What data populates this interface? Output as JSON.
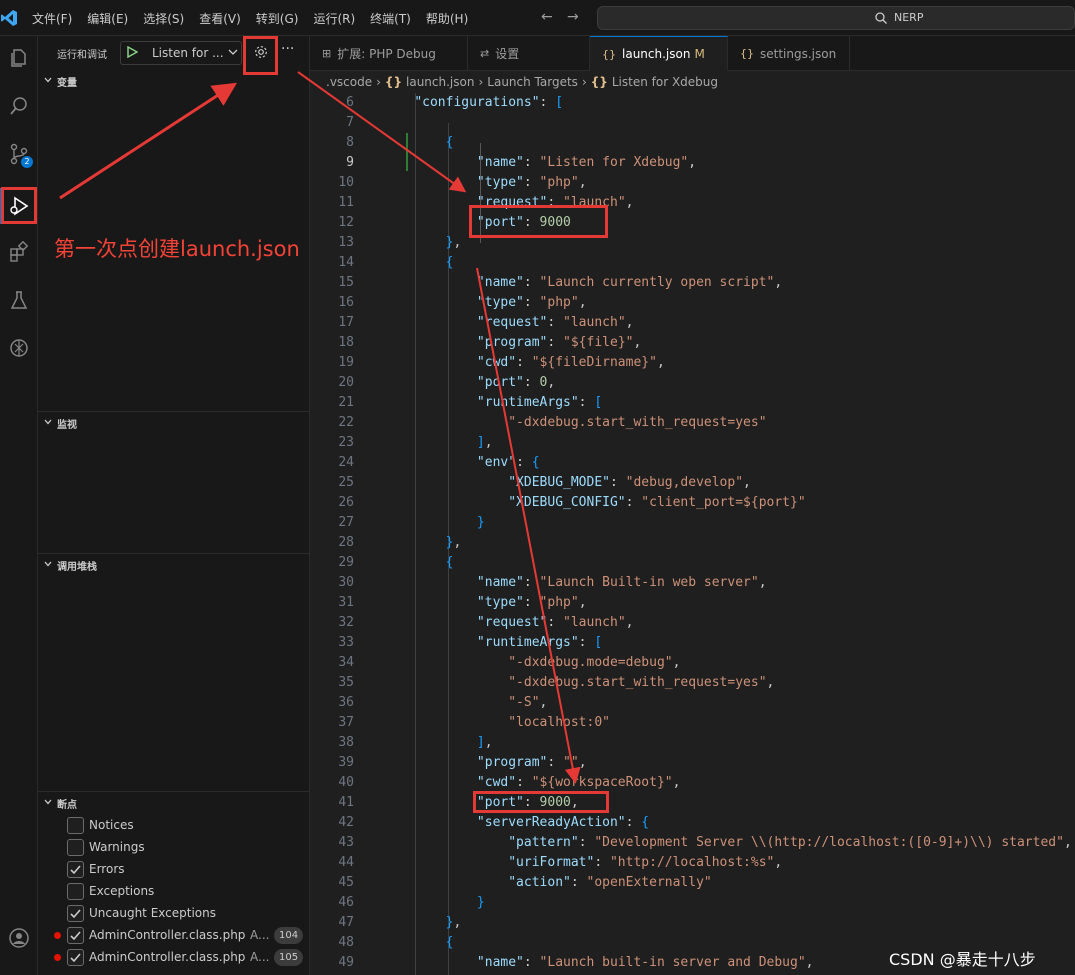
{
  "menu": [
    "文件(F)",
    "编辑(E)",
    "选择(S)",
    "查看(V)",
    "转到(G)",
    "运行(R)",
    "终端(T)",
    "帮助(H)"
  ],
  "command_center": {
    "label": "NERP"
  },
  "activity": {
    "scm_badge": "2"
  },
  "sidebar": {
    "title": "运行和调试",
    "run_config": "Listen for ...",
    "sections": {
      "variables": "变量",
      "watch": "监视",
      "call_stack": "调用堆栈",
      "breakpoints": "断点"
    },
    "breakpoints": [
      {
        "label": "Notices",
        "checked": false
      },
      {
        "label": "Warnings",
        "checked": false
      },
      {
        "label": "Errors",
        "checked": true
      },
      {
        "label": "Exceptions",
        "checked": false
      },
      {
        "label": "Uncaught Exceptions",
        "checked": true
      },
      {
        "label": "AdminController.class.php",
        "checked": true,
        "extra": "A...",
        "count": "104"
      },
      {
        "label": "AdminController.class.php",
        "checked": true,
        "extra": "A...",
        "count": "105"
      }
    ]
  },
  "tabs": [
    {
      "label": "扩展: PHP Debug",
      "icon": "extensions-icon"
    },
    {
      "label": "设置",
      "icon": "settings-icon"
    },
    {
      "label": "launch.json",
      "icon": "json-icon",
      "modified": "M",
      "active": true
    },
    {
      "label": "settings.json",
      "icon": "json-icon"
    }
  ],
  "breadcrumb": {
    "folder": ".vscode",
    "file": "launch.json",
    "section": "Launch Targets",
    "item": "Listen for Xdebug"
  },
  "editor": {
    "current_line": 9,
    "lines": [
      {
        "n": 6,
        "t": "    \"configurations\": ["
      },
      {
        "n": 7,
        "t": ""
      },
      {
        "n": 8,
        "t": "        {"
      },
      {
        "n": 9,
        "t": "            \"name\": \"Listen for Xdebug\","
      },
      {
        "n": 10,
        "t": "            \"type\": \"php\","
      },
      {
        "n": 11,
        "t": "            \"request\": \"launch\","
      },
      {
        "n": 12,
        "t": "            \"port\": 9000"
      },
      {
        "n": 13,
        "t": "        },"
      },
      {
        "n": 14,
        "t": "        {"
      },
      {
        "n": 15,
        "t": "            \"name\": \"Launch currently open script\","
      },
      {
        "n": 16,
        "t": "            \"type\": \"php\","
      },
      {
        "n": 17,
        "t": "            \"request\": \"launch\","
      },
      {
        "n": 18,
        "t": "            \"program\": \"${file}\","
      },
      {
        "n": 19,
        "t": "            \"cwd\": \"${fileDirname}\","
      },
      {
        "n": 20,
        "t": "            \"port\": 0,"
      },
      {
        "n": 21,
        "t": "            \"runtimeArgs\": ["
      },
      {
        "n": 22,
        "t": "                \"-dxdebug.start_with_request=yes\""
      },
      {
        "n": 23,
        "t": "            ],"
      },
      {
        "n": 24,
        "t": "            \"env\": {"
      },
      {
        "n": 25,
        "t": "                \"XDEBUG_MODE\": \"debug,develop\","
      },
      {
        "n": 26,
        "t": "                \"XDEBUG_CONFIG\": \"client_port=${port}\""
      },
      {
        "n": 27,
        "t": "            }"
      },
      {
        "n": 28,
        "t": "        },"
      },
      {
        "n": 29,
        "t": "        {"
      },
      {
        "n": 30,
        "t": "            \"name\": \"Launch Built-in web server\","
      },
      {
        "n": 31,
        "t": "            \"type\": \"php\","
      },
      {
        "n": 32,
        "t": "            \"request\": \"launch\","
      },
      {
        "n": 33,
        "t": "            \"runtimeArgs\": ["
      },
      {
        "n": 34,
        "t": "                \"-dxdebug.mode=debug\","
      },
      {
        "n": 35,
        "t": "                \"-dxdebug.start_with_request=yes\","
      },
      {
        "n": 36,
        "t": "                \"-S\","
      },
      {
        "n": 37,
        "t": "                \"localhost:0\""
      },
      {
        "n": 38,
        "t": "            ],"
      },
      {
        "n": 39,
        "t": "            \"program\": \"\","
      },
      {
        "n": 40,
        "t": "            \"cwd\": \"${workspaceRoot}\","
      },
      {
        "n": 41,
        "t": "            \"port\": 9000,"
      },
      {
        "n": 42,
        "t": "            \"serverReadyAction\": {"
      },
      {
        "n": 43,
        "t": "                \"pattern\": \"Development Server \\\\(http://localhost:([0-9]+)\\\\) started\","
      },
      {
        "n": 44,
        "t": "                \"uriFormat\": \"http://localhost:%s\","
      },
      {
        "n": 45,
        "t": "                \"action\": \"openExternally\""
      },
      {
        "n": 46,
        "t": "            }"
      },
      {
        "n": 47,
        "t": "        },"
      },
      {
        "n": 48,
        "t": "        {"
      },
      {
        "n": 49,
        "t": "            \"name\": \"Launch built-in server and Debug\","
      }
    ]
  },
  "annotation": {
    "text": "第一次点创建launch.json",
    "color": "#e53935"
  },
  "watermark": "CSDN @暴走十八步",
  "colors": {
    "key": "#9cdcfe",
    "string": "#ce9178",
    "number": "#b5cea8",
    "bracket_outer": "#da70d6",
    "bracket_inner": "#179fff",
    "accent": "#0078d4"
  }
}
